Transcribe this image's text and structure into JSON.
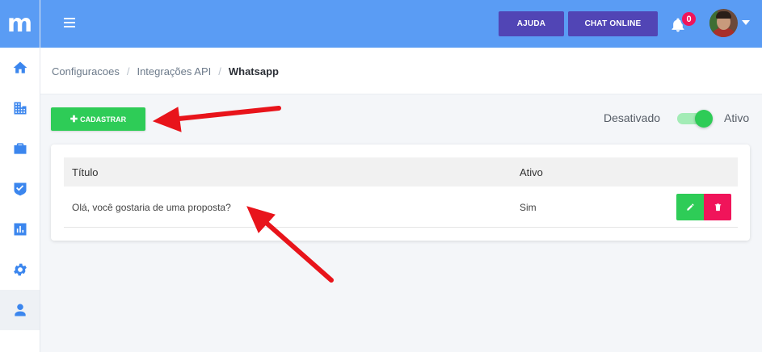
{
  "sidebar": {
    "logo": "m",
    "items": [
      {
        "name": "home",
        "icon": "home-icon"
      },
      {
        "name": "buildings",
        "icon": "building-icon"
      },
      {
        "name": "portfolio",
        "icon": "briefcase-icon"
      },
      {
        "name": "tasks",
        "icon": "shield-check-icon"
      },
      {
        "name": "reports",
        "icon": "bar-chart-icon"
      },
      {
        "name": "settings",
        "icon": "gear-icon"
      },
      {
        "name": "users",
        "icon": "user-icon"
      }
    ]
  },
  "header": {
    "help_label": "AJUDA",
    "chat_label": "CHAT ONLINE",
    "notification_count": "0"
  },
  "breadcrumb": {
    "items": [
      "Configuracoes",
      "Integrações API"
    ],
    "current": "Whatsapp"
  },
  "actions": {
    "add_label": "CADASTRAR",
    "toggle_off_label": "Desativado",
    "toggle_on_label": "Ativo",
    "toggle_state": "on"
  },
  "table": {
    "columns": [
      "Título",
      "Ativo"
    ],
    "rows": [
      {
        "title": "Olá, você gostaria de uma proposta?",
        "active": "Sim"
      }
    ]
  },
  "colors": {
    "primary": "#5a9cf4",
    "header_button": "#5145b5",
    "success": "#2ecc57",
    "danger": "#f0145a",
    "annotation_arrow": "#e8141b"
  }
}
